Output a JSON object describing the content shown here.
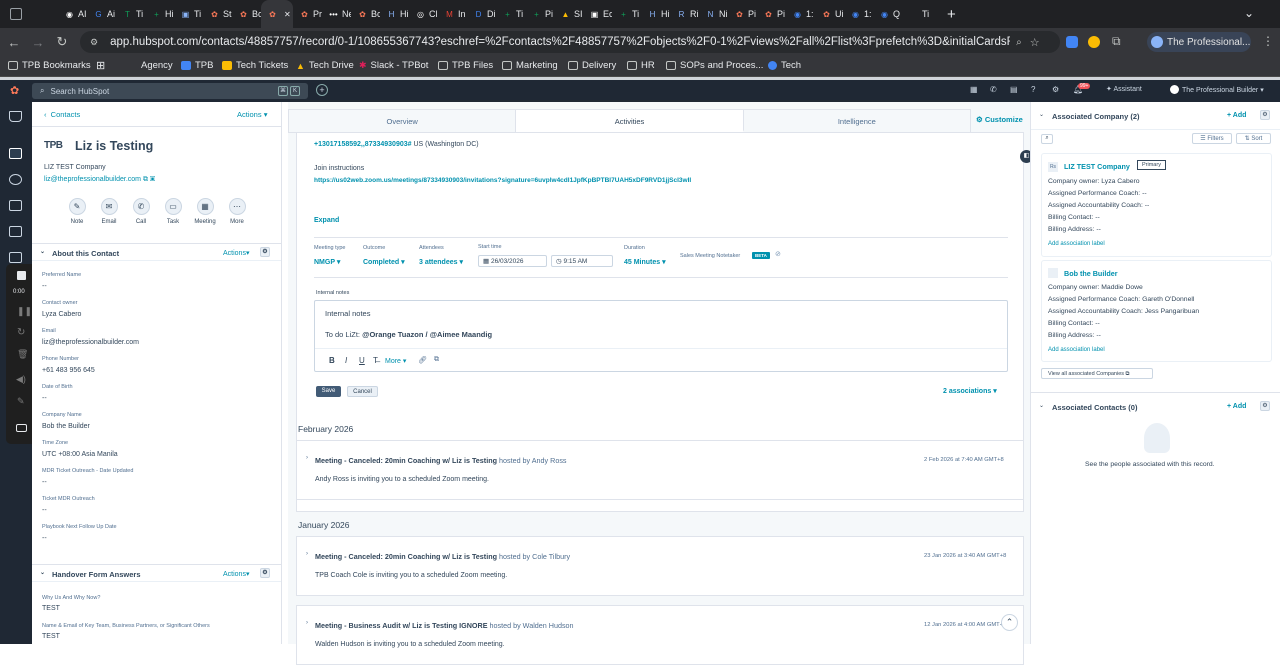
{
  "browser": {
    "tabs": [
      {
        "label": "AI",
        "color": "#ffffff",
        "glyph": "◉"
      },
      {
        "label": "Ai",
        "color": "#4285f4",
        "glyph": "G"
      },
      {
        "label": "Ti",
        "color": "#0f9d58",
        "glyph": "T"
      },
      {
        "label": "Hi",
        "color": "#0f9d58",
        "glyph": "+"
      },
      {
        "label": "Ti",
        "color": "#8ab4f8",
        "glyph": "▣"
      },
      {
        "label": "St",
        "color": "#ff7a59",
        "glyph": "✿"
      },
      {
        "label": "Bc",
        "color": "#ff7a59",
        "glyph": "✿"
      },
      {
        "label": "",
        "color": "#ff7a59",
        "glyph": "✿"
      },
      {
        "label": "Pr",
        "color": "#ff7a59",
        "glyph": "✿"
      },
      {
        "label": "Ne",
        "color": "#ffffff",
        "glyph": "•••"
      },
      {
        "label": "Bc",
        "color": "#ff7a59",
        "glyph": "✿"
      },
      {
        "label": "Hi",
        "color": "#8ab4f8",
        "glyph": "H"
      },
      {
        "label": "Cl",
        "color": "#ffffff",
        "glyph": "◎"
      },
      {
        "label": "In",
        "color": "#ea4335",
        "glyph": "M"
      },
      {
        "label": "Di",
        "color": "#4285f4",
        "glyph": "D"
      },
      {
        "label": "Ti",
        "color": "#0f9d58",
        "glyph": "+"
      },
      {
        "label": "Pi",
        "color": "#0f9d58",
        "glyph": "+"
      },
      {
        "label": "SI",
        "color": "#fbbc04",
        "glyph": "▲"
      },
      {
        "label": "Ec",
        "color": "#ffffff",
        "glyph": "▣"
      },
      {
        "label": "Ti",
        "color": "#0f9d58",
        "glyph": "+"
      },
      {
        "label": "Hi",
        "color": "#8ab4f8",
        "glyph": "H"
      },
      {
        "label": "Ri",
        "color": "#8ab4f8",
        "glyph": "R"
      },
      {
        "label": "Ni",
        "color": "#8ab4f8",
        "glyph": "N"
      },
      {
        "label": "Pi",
        "color": "#ff7a59",
        "glyph": "✿"
      },
      {
        "label": "Pi",
        "color": "#ff7a59",
        "glyph": "✿"
      },
      {
        "label": "1:",
        "color": "#4285f4",
        "glyph": "◉"
      },
      {
        "label": "Ui",
        "color": "#ff7a59",
        "glyph": "✿"
      },
      {
        "label": "1:",
        "color": "#4285f4",
        "glyph": "◉"
      },
      {
        "label": "Q",
        "color": "#4285f4",
        "glyph": "◉"
      },
      {
        "label": "Ti",
        "color": "#35363a",
        "glyph": ""
      }
    ],
    "url": "app.hubspot.com/contacts/48857757/record/0-1/108655367743?eschref=%2Fcontacts%2F48857757%2Fobjects%2F0-1%2Fviews%2Fall%2Flist%3Fprefetch%3D&initialCardsReadyMarkerExtension=P...",
    "profile": "The Professional...",
    "bookmarks": [
      "TPB Bookmarks",
      "Agency",
      "TPB",
      "Tech Tickets",
      "Tech Drive",
      "Slack - TPBot",
      "TPB Files",
      "Marketing",
      "Delivery",
      "HR",
      "SOPs and Proces...",
      "Tech"
    ]
  },
  "hubspot_nav": {
    "search_placeholder": "Search HubSpot",
    "kbd1": "⌘",
    "kbd2": "K",
    "notif_count": "99+",
    "assistant": "Assistant",
    "account": "The Professional Builder"
  },
  "contact": {
    "breadcrumb": "Contacts",
    "actions": "Actions",
    "logo": "TPB",
    "name": "Liz is Testing",
    "company": "LIZ TEST Company",
    "email": "liz@theprofessionalbuilder.com",
    "buttons": [
      "Note",
      "Email",
      "Call",
      "Task",
      "Meeting",
      "More"
    ],
    "about_title": "About this Contact",
    "about_actions": "Actions",
    "fields": [
      {
        "label": "Preferred Name",
        "value": "--"
      },
      {
        "label": "Contact owner",
        "value": "Lyza Cabero"
      },
      {
        "label": "Email",
        "value": "liz@theprofessionalbuilder.com"
      },
      {
        "label": "Phone Number",
        "value": "+61 483 956 645"
      },
      {
        "label": "Date of Birth",
        "value": "--"
      },
      {
        "label": "Company Name",
        "value": "Bob the Builder"
      },
      {
        "label": "Time Zone",
        "value": "UTC +08:00 Asia Manila"
      },
      {
        "label": "MDR Ticket Outreach - Date Updated",
        "value": "--"
      },
      {
        "label": "Ticket MDR Outreach",
        "value": "--"
      },
      {
        "label": "Playbook Next Follow Up Date",
        "value": "--"
      }
    ],
    "handover_title": "Handover Form Answers",
    "handover_actions": "Actions",
    "handover_fields": [
      {
        "label": "Why Us And Why Now?",
        "value": "TEST"
      },
      {
        "label": "Name & Email of Key Team, Business Partners, or Significant Others",
        "value": "TEST"
      }
    ]
  },
  "recording": {
    "time": "0:00"
  },
  "center": {
    "tabs": [
      "Overview",
      "Activities",
      "Intelligence"
    ],
    "customize": "Customize",
    "dial_in": "+13017158592,,87334930903#",
    "dial_loc": "US (Washington DC)",
    "join_label": "Join instructions",
    "join_link": "https://us02web.zoom.us/meetings/87334930903/invitations?signature=6uvplw4cdI1JpfKpBPTBl7UAH5xDF9RVD1jjScI3wII",
    "expand": "Expand",
    "meeting_type_label": "Meeting type",
    "meeting_type": "NMGP",
    "outcome_label": "Outcome",
    "outcome": "Completed",
    "attendees_label": "Attendees",
    "attendees": "3 attendees",
    "start_label": "Start time",
    "start_date": "26/03/2026",
    "start_time": "9:15 AM",
    "duration_label": "Duration",
    "duration": "45 Minutes",
    "notetaker": "Sales Meeting Notetaker",
    "beta": "BETA",
    "internal_notes_label": "Internal notes",
    "notes_heading": "Internal notes",
    "notes_body_prefix": "To do LiZt:",
    "notes_mentions": "@Orange Tuazon / @Aimee Maandig",
    "more": "More",
    "save": "Save",
    "cancel": "Cancel",
    "associations": "2 associations",
    "groups": [
      {
        "month": "February 2026",
        "events": [
          {
            "title": "Meeting - Canceled: 20min Coaching w/ Liz is Testing",
            "host": "hosted by Andy Ross",
            "date": "2 Feb 2026 at 7:40 AM GMT+8",
            "body": "Andy Ross is inviting you to a scheduled Zoom meeting."
          }
        ]
      },
      {
        "month": "January 2026",
        "events": [
          {
            "title": "Meeting - Canceled: 20min Coaching w/ Liz is Testing",
            "host": "hosted by Cole Tilbury",
            "date": "23 Jan 2026 at 3:40 AM GMT+8",
            "body": "TPB Coach Cole is inviting you to a scheduled Zoom meeting."
          },
          {
            "title": "Meeting - Business Audit w/ Liz is Testing IGNORE",
            "host": "hosted by Walden Hudson",
            "date": "12 Jan 2026 at 4:00 AM GMT+8",
            "body": "Walden Hudson is inviting you to a scheduled Zoom meeting."
          }
        ]
      }
    ]
  },
  "right": {
    "companies_title": "Associated Company (2)",
    "add": "+ Add",
    "filters": "Filters",
    "sort": "Sort",
    "company1": {
      "initials": "Rs",
      "name": "LIZ TEST Company",
      "badge": "Primary",
      "rows": [
        "Company owner: Lyza Cabero",
        "Assigned Performance Coach: --",
        "Assigned Accountability Coach: --",
        "Billing Contact: --",
        "Billing Address: --"
      ],
      "add_label": "Add association label"
    },
    "company2": {
      "name": "Bob the Builder",
      "rows": [
        "Company owner: Maddie Dowe",
        "Assigned Performance Coach: Gareth O'Donnell",
        "Assigned Accountability Coach: Jess Pangaribuan",
        "Billing Contact: --",
        "Billing Address: --"
      ],
      "add_label": "Add association label"
    },
    "view_all": "View all associated Companies",
    "contacts_title": "Associated Contacts (0)",
    "contacts_add": "+ Add",
    "empty_text": "See the people associated with this record."
  },
  "colors": {
    "hubspot_orange": "#ff7a59",
    "link": "#0091ae",
    "nav_dark": "#1f2834",
    "chrome_dark": "#202124"
  }
}
